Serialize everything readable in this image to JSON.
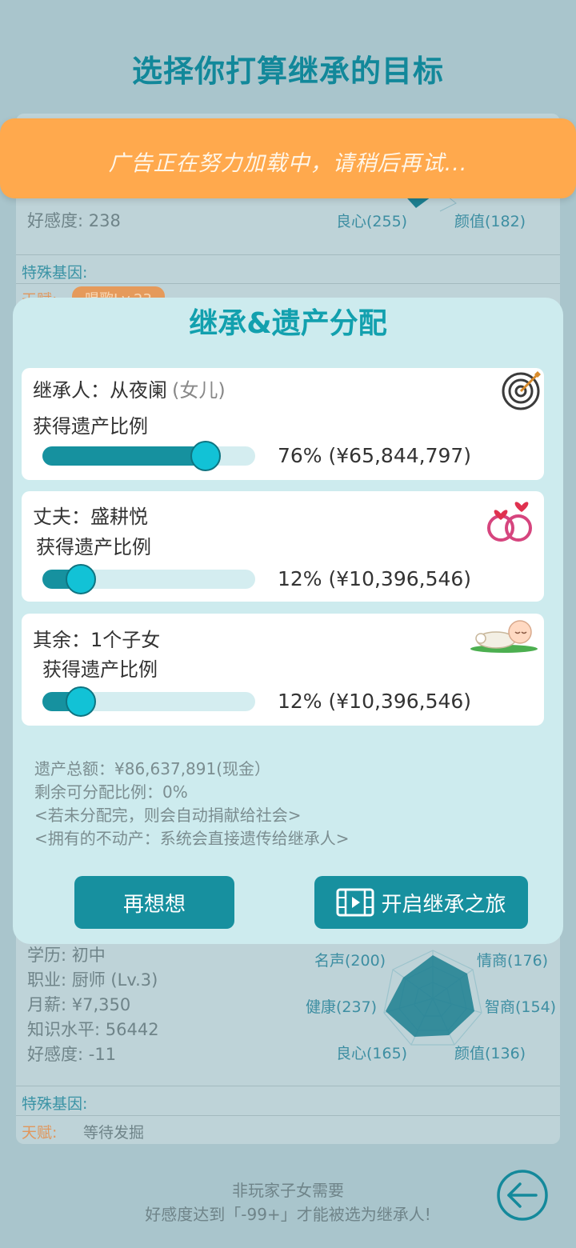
{
  "page": {
    "title": "选择你打算继承的目标"
  },
  "bg_card_top": {
    "affection": "好感度: 238",
    "radar_labels": {
      "conscience": "良心(255)",
      "looks": "颜值(182)"
    },
    "genes_label": "特殊基因:",
    "talent_label": "天赋:",
    "talent_tag": "唱歌Lv.23"
  },
  "toast": {
    "text": "广告正在努力加载中，请稍后再试..."
  },
  "modal": {
    "title": "继承&遗产分配",
    "cards": [
      {
        "name": "继承人：从夜阑",
        "relation": "(女儿)",
        "sub": "获得遗产比例",
        "percent_text": "76% (¥65,844,797)",
        "share": 0.76,
        "icon": "target-arrow-icon"
      },
      {
        "name": "丈夫：盛耕悦",
        "sub": "获得遗产比例",
        "percent_text": "12% (¥10,396,546)",
        "share": 0.12,
        "icon": "wedding-rings-icon"
      },
      {
        "name": "其余：1个子女",
        "sub": "获得遗产比例",
        "percent_text": "12% (¥10,396,546)",
        "share": 0.12,
        "icon": "sleeping-baby-icon"
      }
    ],
    "info": {
      "total": "遗产总额：¥86,637,891(现金）",
      "remaining": "剩余可分配比例：0%",
      "note1": "<若未分配完，则会自动捐献给社会>",
      "note2": "<拥有的不动产：系统会直接遗传给继承人>"
    },
    "buttons": {
      "reconsider": "再想想",
      "start": "开启继承之旅"
    }
  },
  "bg_card_bottom": {
    "education": "学历: 初中",
    "job": "职业: 厨师 (Lv.3)",
    "salary": "月薪: ¥7,350",
    "knowledge": "知识水平: 56442",
    "affection": "好感度: -11",
    "radar_labels": {
      "fame": "名声(200)",
      "eq": "情商(176)",
      "health": "健康(237)",
      "iq": "智商(154)",
      "conscience": "良心(165)",
      "looks": "颜值(136)"
    },
    "genes_label": "特殊基因:",
    "talent_label": "天赋:",
    "talent_value": "等待发掘"
  },
  "footer": {
    "line1": "非玩家子女需要",
    "line2": "好感度达到「-99+」才能被选为继承人!"
  },
  "colors": {
    "accent": "#12889a",
    "toast": "#ffa94d",
    "modal_bg": "#cdebee",
    "button": "#17909f"
  }
}
